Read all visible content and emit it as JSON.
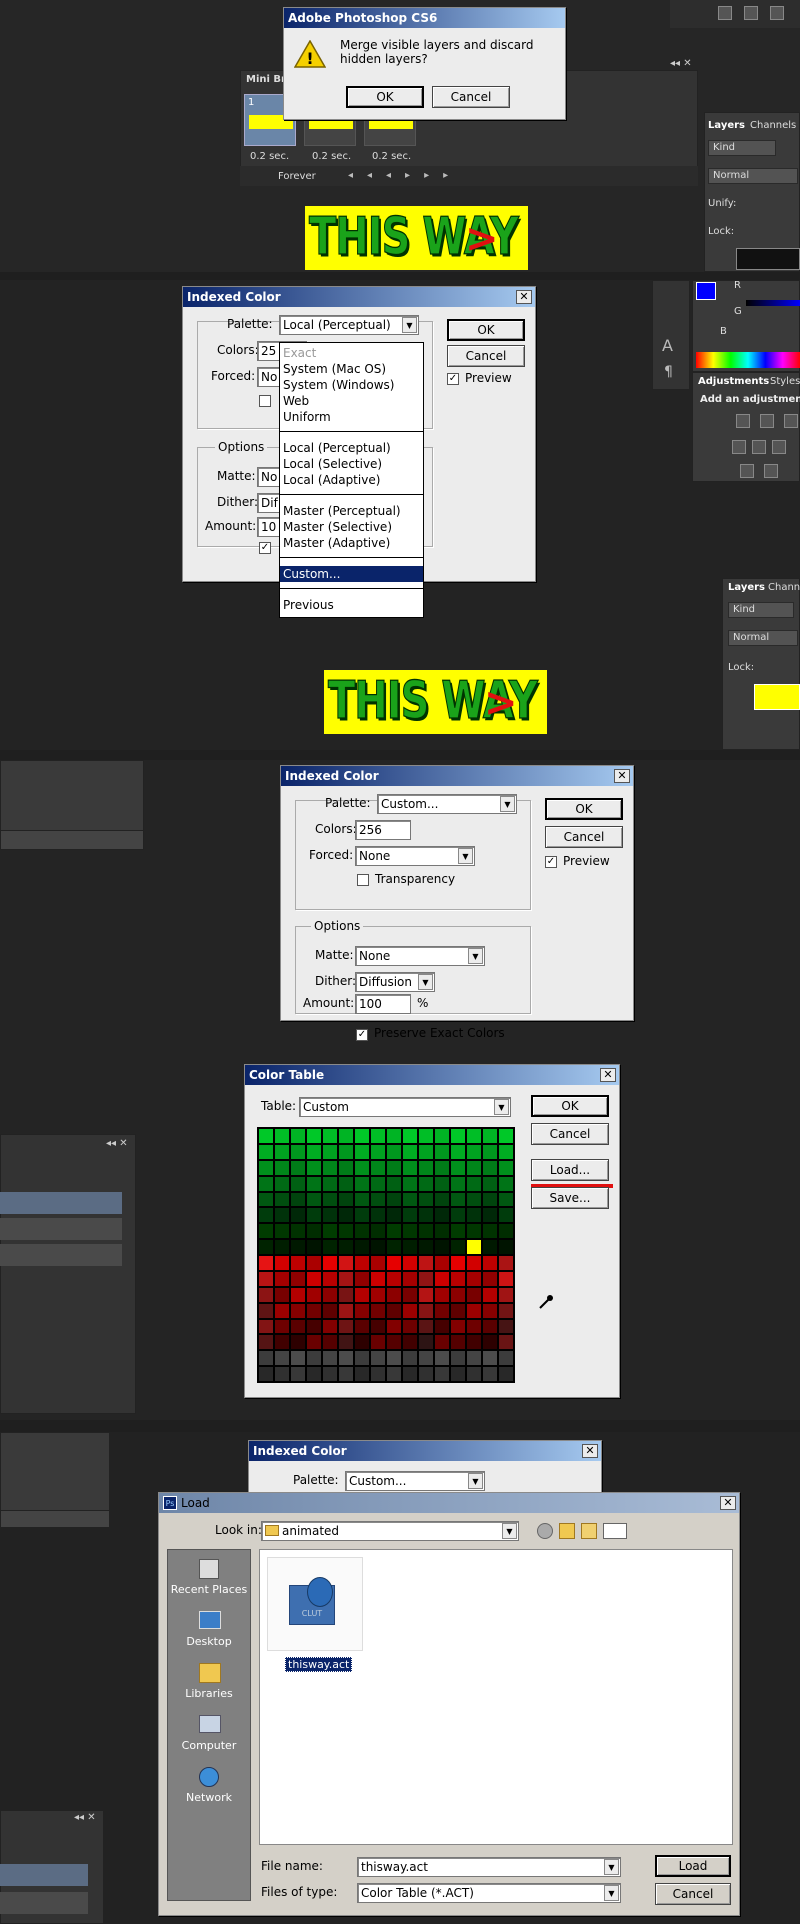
{
  "panel1": {
    "merge_dialog": {
      "title": "Adobe Photoshop CS6",
      "message": "Merge visible layers and discard hidden layers?",
      "ok": "OK",
      "cancel": "Cancel"
    },
    "mini_bridge_tab": "Mini Br",
    "frames": [
      {
        "num": "1",
        "delay": "0.2 sec."
      },
      {
        "num": "",
        "delay": "0.2 sec."
      },
      {
        "num": "",
        "delay": "0.2 sec."
      }
    ],
    "loop": "Forever",
    "layers_panel": {
      "tab_layers": "Layers",
      "tab_channels": "Channels",
      "kind": "Kind",
      "blend": "Normal",
      "unify": "Unify:",
      "lock": "Lock:"
    }
  },
  "banner": {
    "text": "THIS WAY",
    "arrow": ">"
  },
  "panel2": {
    "dialog": {
      "title": "Indexed Color",
      "palette_label": "Palette:",
      "palette_value": "Local (Perceptual)",
      "colors_label": "Colors:",
      "colors_value": "25",
      "forced_label": "Forced:",
      "forced_value": "No",
      "options_label": "Options",
      "matte_label": "Matte:",
      "matte_value": "No",
      "dither_label": "Dither:",
      "dither_value": "Dif",
      "amount_label": "Amount:",
      "amount_value": "10",
      "ok": "OK",
      "cancel": "Cancel",
      "preview": "Preview"
    },
    "palette_menu": {
      "group1": [
        "Exact",
        "System (Mac OS)",
        "System (Windows)",
        "Web",
        "Uniform"
      ],
      "group2": [
        "Local (Perceptual)",
        "Local (Selective)",
        "Local (Adaptive)"
      ],
      "group3": [
        "Master (Perceptual)",
        "Master (Selective)",
        "Master (Adaptive)"
      ],
      "selected": "Custom...",
      "previous": "Previous"
    },
    "adjustments": {
      "tab_adjustments": "Adjustments",
      "tab_styles": "Styles",
      "add": "Add an adjustment",
      "r": "R",
      "g": "G",
      "b": "B"
    },
    "layers_panel": {
      "tab_layers": "Layers",
      "tab_channels": "Chann",
      "kind": "Kind",
      "blend": "Normal",
      "lock": "Lock:"
    }
  },
  "panel3": {
    "dialog": {
      "title": "Indexed Color",
      "palette_label": "Palette:",
      "palette_value": "Custom...",
      "colors_label": "Colors:",
      "colors_value": "256",
      "forced_label": "Forced:",
      "forced_value": "None",
      "transparency": "Transparency",
      "options_label": "Options",
      "matte_label": "Matte:",
      "matte_value": "None",
      "dither_label": "Dither:",
      "dither_value": "Diffusion",
      "amount_label": "Amount:",
      "amount_value": "100",
      "amount_unit": "%",
      "preserve": "Preserve Exact Colors",
      "ok": "OK",
      "cancel": "Cancel",
      "preview": "Preview"
    },
    "color_table": {
      "title": "Color Table",
      "table_label": "Table:",
      "table_value": "Custom",
      "ok": "OK",
      "cancel": "Cancel",
      "load": "Load...",
      "save": "Save..."
    }
  },
  "panel4": {
    "bg_dialog": {
      "title": "Indexed Color",
      "palette_label": "Palette:",
      "palette_value": "Custom..."
    },
    "load_dialog": {
      "title": "Load",
      "look_in_label": "Look in:",
      "look_in_value": "animated",
      "places": [
        "Recent Places",
        "Desktop",
        "Libraries",
        "Computer",
        "Network"
      ],
      "file": {
        "name": "thisway.act",
        "badge": "CLUT"
      },
      "file_name_label": "File name:",
      "file_name_value": "thisway.act",
      "file_type_label": "Files of type:",
      "file_type_value": "Color Table (*.ACT)",
      "load_btn": "Load",
      "cancel_btn": "Cancel"
    }
  },
  "colors": {
    "accent_red": "#e01010",
    "banner_yellow": "#ffff00",
    "title_blue": "#0a246a",
    "selection_blue": "#0a246a"
  }
}
